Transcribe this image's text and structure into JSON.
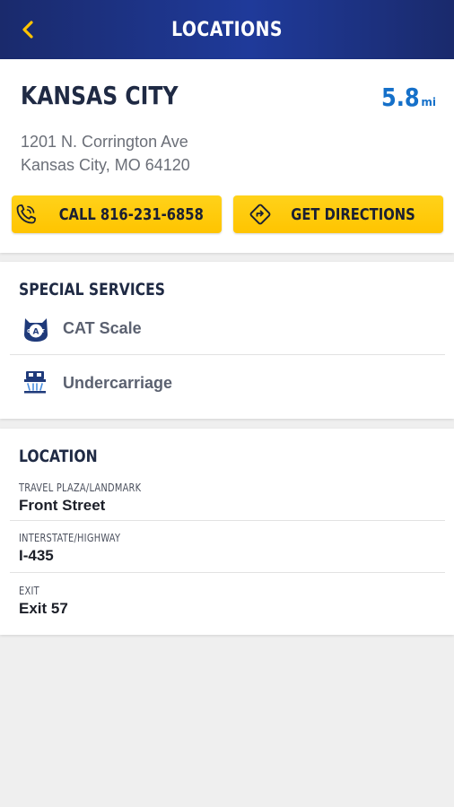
{
  "header": {
    "title": "LOCATIONS",
    "back_icon": "chevron-left-icon",
    "accent": "#ffc400",
    "background": "#1a2a6c"
  },
  "store": {
    "city": "KANSAS CITY",
    "distance_value": "5.8",
    "distance_unit": "mi",
    "address_line1": "1201 N. Corrington Ave",
    "address_line2": "Kansas City, MO 64120",
    "call_label": "CALL 816-231-6858",
    "directions_label": "GET DIRECTIONS",
    "call_icon": "phone-icon",
    "directions_icon": "directions-icon",
    "distance_color": "#1570c9"
  },
  "special_services": {
    "title": "SPECIAL SERVICES",
    "items": [
      {
        "label": "CAT Scale",
        "icon": "cat-scale-icon"
      },
      {
        "label": "Undercarriage",
        "icon": "undercarriage-wash-icon"
      }
    ]
  },
  "location": {
    "title": "LOCATION",
    "fields": [
      {
        "label": "TRAVEL PLAZA/LANDMARK",
        "value": "Front Street"
      },
      {
        "label": "INTERSTATE/HIGHWAY",
        "value": "I-435"
      },
      {
        "label": "EXIT",
        "value": "Exit 57"
      }
    ]
  }
}
